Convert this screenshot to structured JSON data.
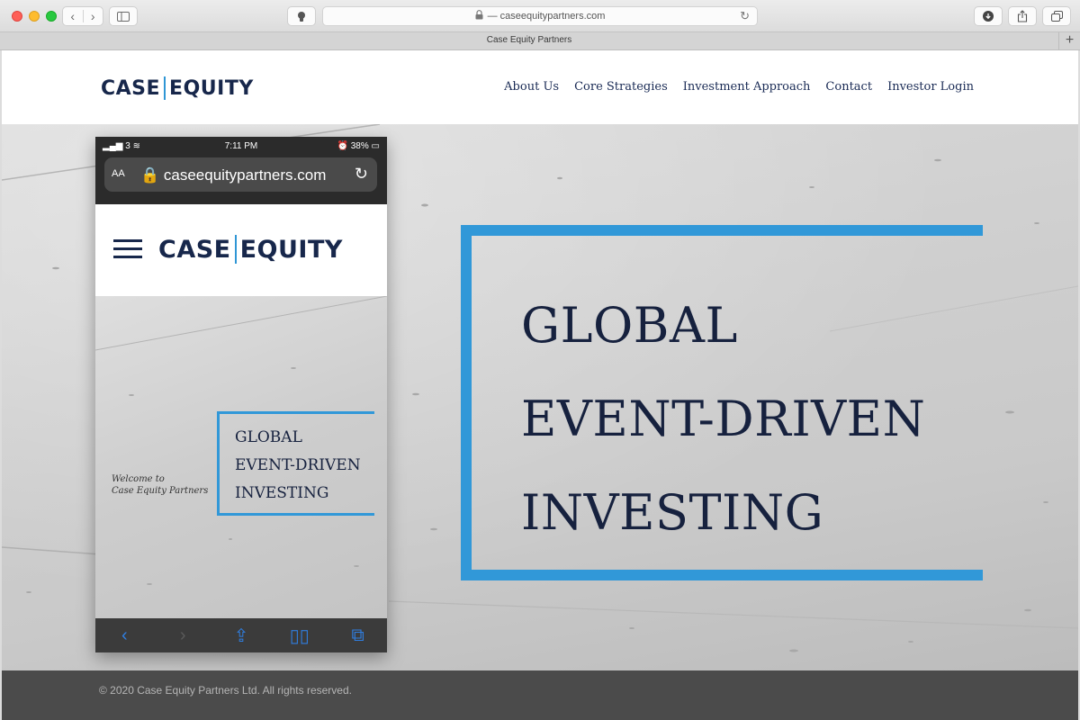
{
  "browser": {
    "url": "— caseequitypartners.com",
    "tab_title": "Case Equity Partners",
    "new_tab": "+"
  },
  "site": {
    "logo_left": "CASE",
    "logo_right": "EQUITY",
    "nav": [
      "About Us",
      "Core Strategies",
      "Investment Approach",
      "Contact",
      "Investor Login"
    ]
  },
  "hero": {
    "headline": [
      "GLOBAL",
      "EVENT-DRIVEN",
      "INVESTING"
    ],
    "accent": "#3198d8"
  },
  "phone": {
    "carrier": "3",
    "time": "7:11 PM",
    "battery": "38%",
    "text_size": "AA",
    "url": "caseequitypartners.com",
    "logo_left": "CASE",
    "logo_right": "EQUITY",
    "headline": [
      "GLOBAL",
      "EVENT-DRIVEN",
      "INVESTING"
    ],
    "welcome_1": "Welcome to",
    "welcome_2": "Case Equity Partners"
  },
  "footer": {
    "copyright": "© 2020 Case Equity Partners Ltd. All rights reserved."
  }
}
